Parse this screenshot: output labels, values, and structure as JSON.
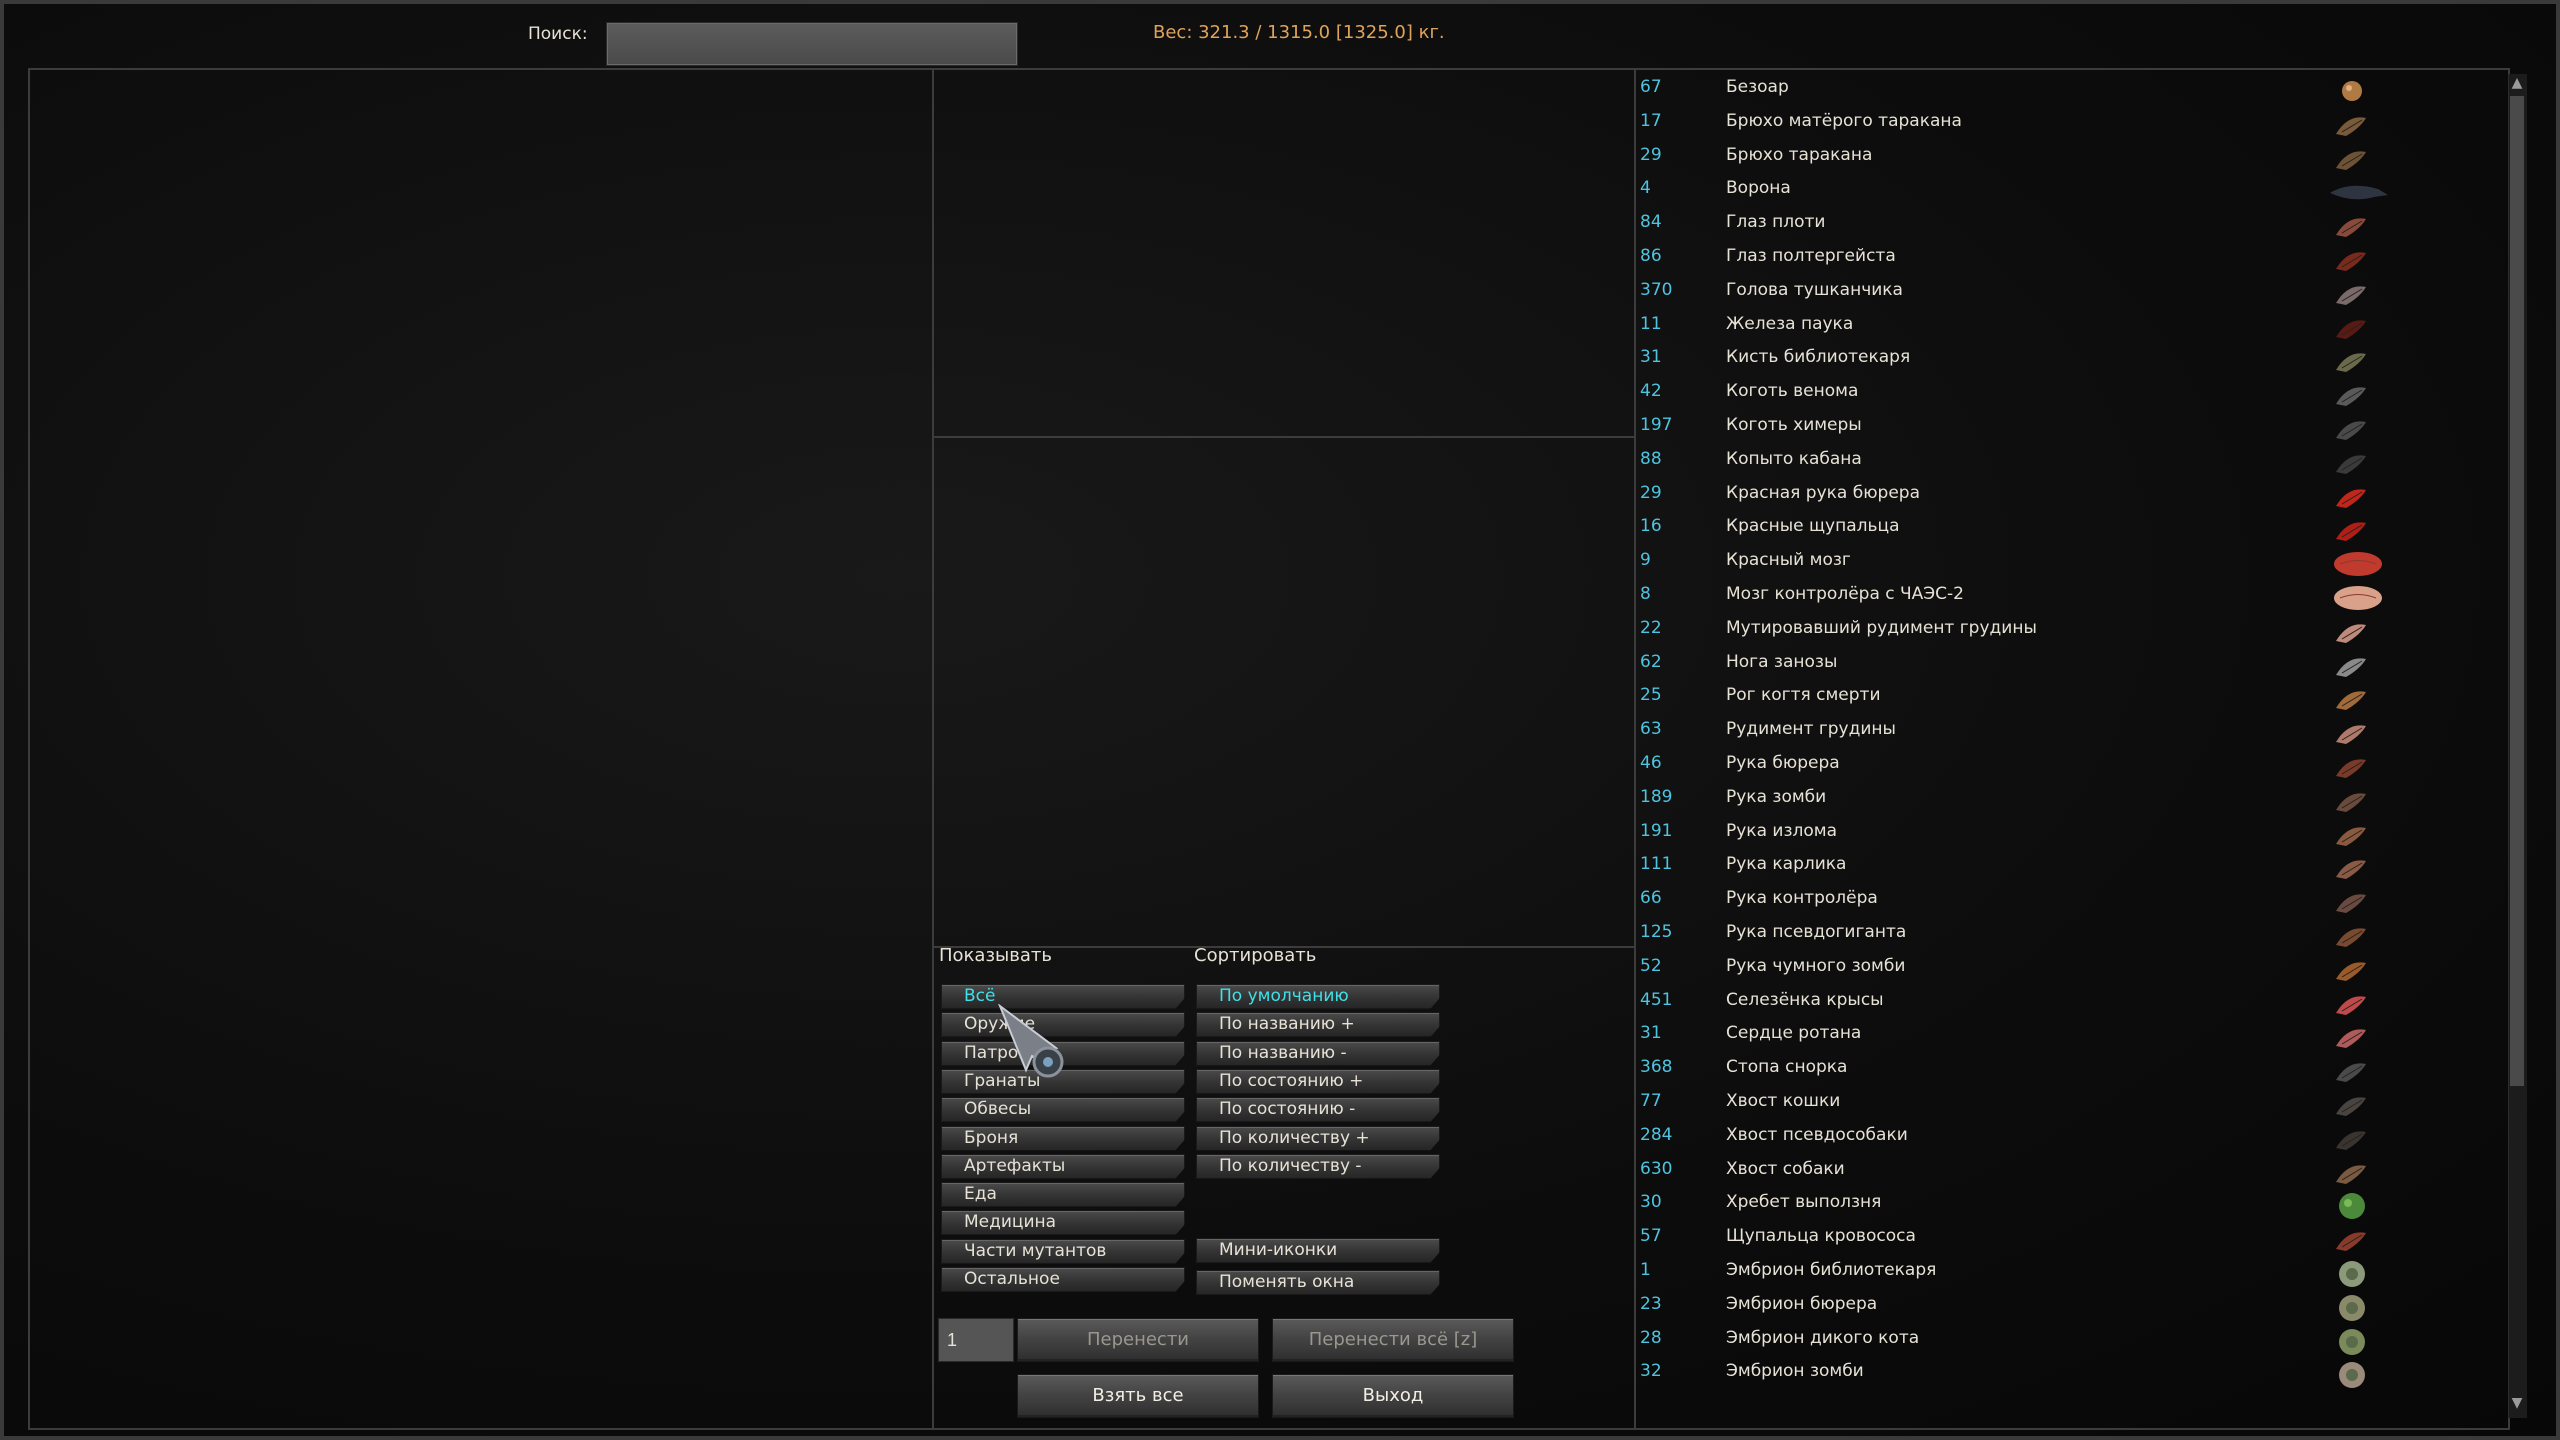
{
  "header": {
    "search_label": "Поиск:",
    "search_value": "",
    "weight": "Вес: 321.3 / 1315.0 [1325.0] кг."
  },
  "filters": {
    "title": "Показывать",
    "items": [
      {
        "label": "Всё",
        "active": true
      },
      {
        "label": "Оружие",
        "active": false
      },
      {
        "label": "Патроны",
        "active": false
      },
      {
        "label": "Гранаты",
        "active": false
      },
      {
        "label": "Обвесы",
        "active": false
      },
      {
        "label": "Броня",
        "active": false
      },
      {
        "label": "Артефакты",
        "active": false
      },
      {
        "label": "Еда",
        "active": false
      },
      {
        "label": "Медицина",
        "active": false
      },
      {
        "label": "Части мутантов",
        "active": false
      },
      {
        "label": "Остальное",
        "active": false
      }
    ]
  },
  "sort": {
    "title": "Сортировать",
    "items": [
      {
        "label": "По умолчанию",
        "active": true
      },
      {
        "label": "По названию +",
        "active": false
      },
      {
        "label": "По названию -",
        "active": false
      },
      {
        "label": "По состоянию +",
        "active": false
      },
      {
        "label": "По состоянию -",
        "active": false
      },
      {
        "label": "По количеству +",
        "active": false
      },
      {
        "label": "По количеству -",
        "active": false
      }
    ],
    "mini_icons": "Мини-иконки",
    "swap_windows": "Поменять окна"
  },
  "actions": {
    "quantity": "1",
    "transfer": "Перенести",
    "transfer_all": "Перенести всё [z]",
    "take_all": "Взять все",
    "exit": "Выход"
  },
  "items": [
    {
      "count": "67",
      "name": "Безоар",
      "icon": "bezoar-icon",
      "color": "#b07a45"
    },
    {
      "count": "17",
      "name": "Брюхо матёрого таракана",
      "icon": "cockroach-belly-icon",
      "color": "#7a5a3a"
    },
    {
      "count": "29",
      "name": "Брюхо таракана",
      "icon": "cockroach-belly-icon",
      "color": "#6e5236"
    },
    {
      "count": "4",
      "name": "Ворона",
      "icon": "crow-icon",
      "color": "#2e3440"
    },
    {
      "count": "84",
      "name": "Глаз плоти",
      "icon": "eye-icon",
      "color": "#8a4a3a"
    },
    {
      "count": "86",
      "name": "Глаз полтергейста",
      "icon": "eye-icon",
      "color": "#7a2a1a"
    },
    {
      "count": "370",
      "name": "Голова тушканчика",
      "icon": "head-icon",
      "color": "#7a6a6a"
    },
    {
      "count": "11",
      "name": "Железа паука",
      "icon": "gland-icon",
      "color": "#5a1a14"
    },
    {
      "count": "31",
      "name": "Кисть библиотекаря",
      "icon": "hand-icon",
      "color": "#6a6a4a"
    },
    {
      "count": "42",
      "name": "Коготь венома",
      "icon": "claw-icon",
      "color": "#5a5a5a"
    },
    {
      "count": "197",
      "name": "Коготь химеры",
      "icon": "claw-icon",
      "color": "#4a4a4a"
    },
    {
      "count": "88",
      "name": "Копыто кабана",
      "icon": "hoof-icon",
      "color": "#3a3a3a"
    },
    {
      "count": "29",
      "name": "Красная рука бюрера",
      "icon": "hand-icon",
      "color": "#c0261a"
    },
    {
      "count": "16",
      "name": "Красные щупальца",
      "icon": "tentacle-icon",
      "color": "#b01e16"
    },
    {
      "count": "9",
      "name": "Красный мозг",
      "icon": "brain-icon",
      "color": "#c03a2e"
    },
    {
      "count": "8",
      "name": "Мозг контролёра с ЧАЭС-2",
      "icon": "brain-icon",
      "color": "#d9a08a"
    },
    {
      "count": "22",
      "name": "Мутировавший рудимент грудины",
      "icon": "sternum-icon",
      "color": "#c08a7a"
    },
    {
      "count": "62",
      "name": "Нога занозы",
      "icon": "leg-icon",
      "color": "#8a8a8a"
    },
    {
      "count": "25",
      "name": "Рог когтя смерти",
      "icon": "horn-icon",
      "color": "#a06a3a"
    },
    {
      "count": "63",
      "name": "Рудимент грудины",
      "icon": "sternum-icon",
      "color": "#b07a6a"
    },
    {
      "count": "46",
      "name": "Рука бюрера",
      "icon": "hand-icon",
      "color": "#7a3a2a"
    },
    {
      "count": "189",
      "name": "Рука зомби",
      "icon": "hand-icon",
      "color": "#6a4a3a"
    },
    {
      "count": "191",
      "name": "Рука излома",
      "icon": "hand-icon",
      "color": "#8a5a40"
    },
    {
      "count": "111",
      "name": "Рука карлика",
      "icon": "hand-icon",
      "color": "#8a5a44"
    },
    {
      "count": "66",
      "name": "Рука контролёра",
      "icon": "hand-icon",
      "color": "#6a4a3e"
    },
    {
      "count": "125",
      "name": "Рука псевдогиганта",
      "icon": "hand-icon",
      "color": "#7a4a30"
    },
    {
      "count": "52",
      "name": "Рука чумного зомби",
      "icon": "hand-icon",
      "color": "#9a5a2a"
    },
    {
      "count": "451",
      "name": "Селезёнка крысы",
      "icon": "spleen-icon",
      "color": "#c04a4a"
    },
    {
      "count": "31",
      "name": "Сердце ротана",
      "icon": "heart-icon",
      "color": "#b05a5a"
    },
    {
      "count": "368",
      "name": "Стопа снорка",
      "icon": "foot-icon",
      "color": "#4a4a4a"
    },
    {
      "count": "77",
      "name": "Хвост кошки",
      "icon": "tail-icon",
      "color": "#4a4440"
    },
    {
      "count": "284",
      "name": "Хвост псевдособаки",
      "icon": "tail-icon",
      "color": "#3a3430"
    },
    {
      "count": "630",
      "name": "Хвост собаки",
      "icon": "tail-icon",
      "color": "#7a5a40"
    },
    {
      "count": "30",
      "name": "Хребет выползня",
      "icon": "spine-icon",
      "color": "#4a8a3a"
    },
    {
      "count": "57",
      "name": "Щупальца кровососа",
      "icon": "tentacle-icon",
      "color": "#8a3a2a"
    },
    {
      "count": "1",
      "name": "Эмбрион библиотекаря",
      "icon": "embryo-icon",
      "color": "#8a9a7a"
    },
    {
      "count": "23",
      "name": "Эмбрион бюрера",
      "icon": "embryo-icon",
      "color": "#8a8a6a"
    },
    {
      "count": "28",
      "name": "Эмбрион дикого кота",
      "icon": "embryo-icon",
      "color": "#7a8a5a"
    },
    {
      "count": "32",
      "name": "Эмбрион зомби",
      "icon": "embryo-icon",
      "color": "#9a8a7a"
    }
  ]
}
